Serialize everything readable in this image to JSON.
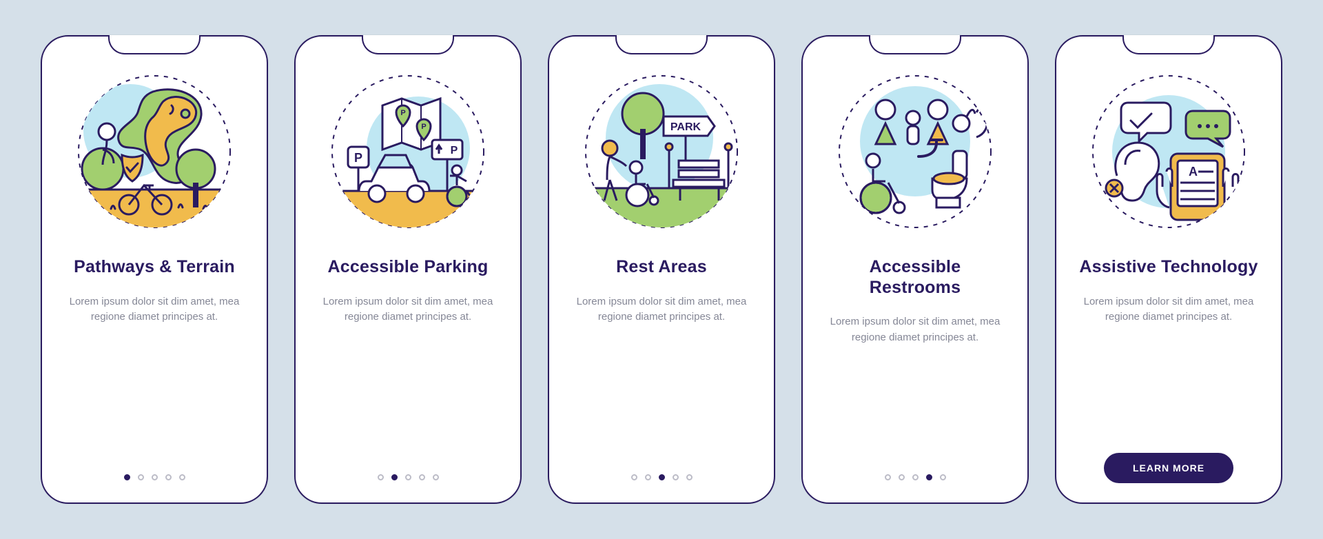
{
  "cards": [
    {
      "title": "Pathways & Terrain",
      "desc": "Lorem ipsum dolor sit dim amet, mea regione diamet principes at.",
      "activeDot": 0,
      "final": false,
      "illus": "pathways-terrain-icon"
    },
    {
      "title": "Accessible Parking",
      "desc": "Lorem ipsum dolor sit dim amet, mea regione diamet principes at.",
      "activeDot": 1,
      "final": false,
      "illus": "accessible-parking-icon"
    },
    {
      "title": "Rest Areas",
      "desc": "Lorem ipsum dolor sit dim amet, mea regione diamet principes at.",
      "activeDot": 2,
      "final": false,
      "illus": "rest-areas-icon"
    },
    {
      "title": "Accessible Restrooms",
      "desc": "Lorem ipsum dolor sit dim amet, mea regione diamet principes at.",
      "activeDot": 3,
      "final": false,
      "illus": "accessible-restrooms-icon"
    },
    {
      "title": "Assistive Technology",
      "desc": "Lorem ipsum dolor sit dim amet, mea regione diamet principes at.",
      "activeDot": 4,
      "final": true,
      "illus": "assistive-technology-icon"
    }
  ],
  "cta_label": "LEARN MORE",
  "palette": {
    "ink": "#2a1b60",
    "skyA": "#bfe7f3",
    "skyB": "#dff2f8",
    "green": "#a2cf6f",
    "greenD": "#86b857",
    "yellow": "#f1bb4c",
    "yellowD": "#e2a939",
    "white": "#ffffff",
    "grey": "#bcbcc7"
  }
}
